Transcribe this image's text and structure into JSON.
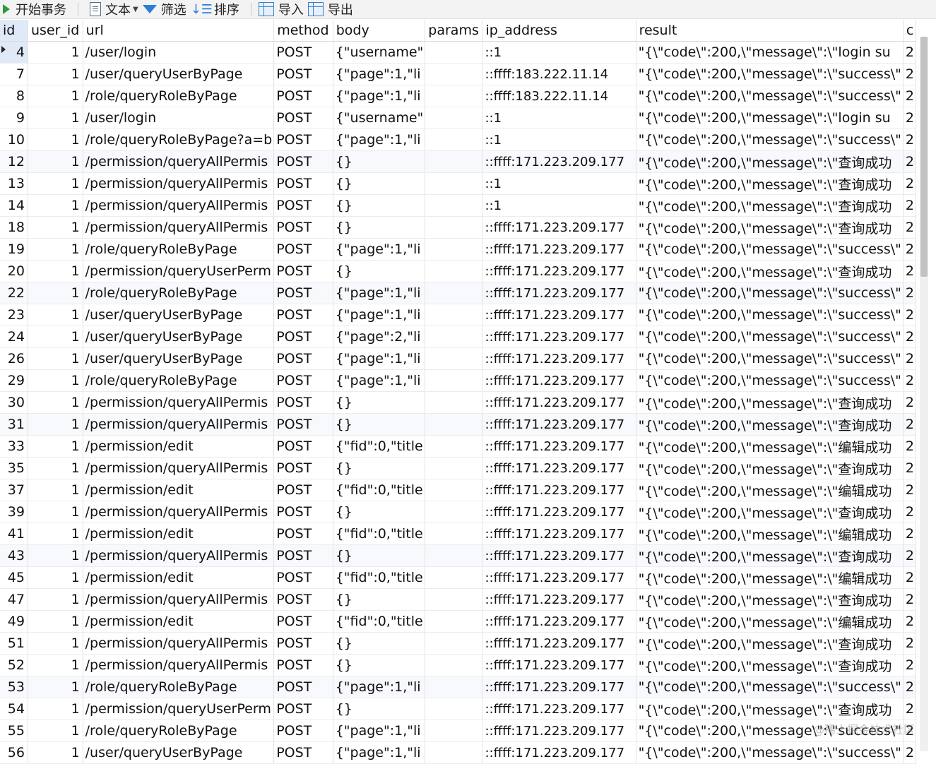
{
  "toolbar": {
    "begin_transaction": "开始事务",
    "text": "文本",
    "filter": "筛选",
    "sort": "排序",
    "import": "导入",
    "export": "导出"
  },
  "columns": [
    "id",
    "user_id",
    "url",
    "method",
    "body",
    "params",
    "ip_address",
    "result",
    "c"
  ],
  "rows": [
    [
      "4",
      "1",
      "/user/login",
      "POST",
      "{\"username\"",
      "",
      "::1",
      "\"{\\\"code\\\":200,\\\"message\\\":\\\"login su",
      "2"
    ],
    [
      "7",
      "1",
      "/user/queryUserByPage",
      "POST",
      "{\"page\":1,\"li",
      "",
      "::ffff:183.222.11.14",
      "\"{\\\"code\\\":200,\\\"message\\\":\\\"success\\\"",
      "2"
    ],
    [
      "8",
      "1",
      "/role/queryRoleByPage",
      "POST",
      "{\"page\":1,\"li",
      "",
      "::ffff:183.222.11.14",
      "\"{\\\"code\\\":200,\\\"message\\\":\\\"success\\\"",
      "2"
    ],
    [
      "9",
      "1",
      "/user/login",
      "POST",
      "{\"username\"",
      "",
      "::1",
      "\"{\\\"code\\\":200,\\\"message\\\":\\\"login su",
      "2"
    ],
    [
      "10",
      "1",
      "/role/queryRoleByPage?a=b",
      "POST",
      "{\"page\":1,\"li",
      "",
      "::1",
      "\"{\\\"code\\\":200,\\\"message\\\":\\\"success\\\"",
      "2"
    ],
    [
      "12",
      "1",
      "/permission/queryAllPermis",
      "POST",
      "{}",
      "",
      "::ffff:171.223.209.177",
      "\"{\\\"code\\\":200,\\\"message\\\":\\\"查询成功",
      "2"
    ],
    [
      "13",
      "1",
      "/permission/queryAllPermis",
      "POST",
      "{}",
      "",
      "::1",
      "\"{\\\"code\\\":200,\\\"message\\\":\\\"查询成功",
      "2"
    ],
    [
      "14",
      "1",
      "/permission/queryAllPermis",
      "POST",
      "{}",
      "",
      "::1",
      "\"{\\\"code\\\":200,\\\"message\\\":\\\"查询成功",
      "2"
    ],
    [
      "18",
      "1",
      "/permission/queryAllPermis",
      "POST",
      "{}",
      "",
      "::ffff:171.223.209.177",
      "\"{\\\"code\\\":200,\\\"message\\\":\\\"查询成功",
      "2"
    ],
    [
      "19",
      "1",
      "/role/queryRoleByPage",
      "POST",
      "{\"page\":1,\"li",
      "",
      "::ffff:171.223.209.177",
      "\"{\\\"code\\\":200,\\\"message\\\":\\\"success\\\"",
      "2"
    ],
    [
      "20",
      "1",
      "/permission/queryUserPerm",
      "POST",
      "{}",
      "",
      "::ffff:171.223.209.177",
      "\"{\\\"code\\\":200,\\\"message\\\":\\\"查询成功",
      "2"
    ],
    [
      "22",
      "1",
      "/role/queryRoleByPage",
      "POST",
      "{\"page\":1,\"li",
      "",
      "::ffff:171.223.209.177",
      "\"{\\\"code\\\":200,\\\"message\\\":\\\"success\\\"",
      "2"
    ],
    [
      "23",
      "1",
      "/user/queryUserByPage",
      "POST",
      "{\"page\":1,\"li",
      "",
      "::ffff:171.223.209.177",
      "\"{\\\"code\\\":200,\\\"message\\\":\\\"success\\\"",
      "2"
    ],
    [
      "24",
      "1",
      "/user/queryUserByPage",
      "POST",
      "{\"page\":2,\"li",
      "",
      "::ffff:171.223.209.177",
      "\"{\\\"code\\\":200,\\\"message\\\":\\\"success\\\"",
      "2"
    ],
    [
      "26",
      "1",
      "/user/queryUserByPage",
      "POST",
      "{\"page\":1,\"li",
      "",
      "::ffff:171.223.209.177",
      "\"{\\\"code\\\":200,\\\"message\\\":\\\"success\\\"",
      "2"
    ],
    [
      "29",
      "1",
      "/role/queryRoleByPage",
      "POST",
      "{\"page\":1,\"li",
      "",
      "::ffff:171.223.209.177",
      "\"{\\\"code\\\":200,\\\"message\\\":\\\"success\\\"",
      "2"
    ],
    [
      "30",
      "1",
      "/permission/queryAllPermis",
      "POST",
      "{}",
      "",
      "::ffff:171.223.209.177",
      "\"{\\\"code\\\":200,\\\"message\\\":\\\"查询成功",
      "2"
    ],
    [
      "31",
      "1",
      "/permission/queryAllPermis",
      "POST",
      "{}",
      "",
      "::ffff:171.223.209.177",
      "\"{\\\"code\\\":200,\\\"message\\\":\\\"查询成功",
      "2"
    ],
    [
      "33",
      "1",
      "/permission/edit",
      "POST",
      "{\"fid\":0,\"title",
      "",
      "::ffff:171.223.209.177",
      "\"{\\\"code\\\":200,\\\"message\\\":\\\"编辑成功",
      "2"
    ],
    [
      "35",
      "1",
      "/permission/queryAllPermis",
      "POST",
      "{}",
      "",
      "::ffff:171.223.209.177",
      "\"{\\\"code\\\":200,\\\"message\\\":\\\"查询成功",
      "2"
    ],
    [
      "37",
      "1",
      "/permission/edit",
      "POST",
      "{\"fid\":0,\"title",
      "",
      "::ffff:171.223.209.177",
      "\"{\\\"code\\\":200,\\\"message\\\":\\\"编辑成功",
      "2"
    ],
    [
      "39",
      "1",
      "/permission/queryAllPermis",
      "POST",
      "{}",
      "",
      "::ffff:171.223.209.177",
      "\"{\\\"code\\\":200,\\\"message\\\":\\\"查询成功",
      "2"
    ],
    [
      "41",
      "1",
      "/permission/edit",
      "POST",
      "{\"fid\":0,\"title",
      "",
      "::ffff:171.223.209.177",
      "\"{\\\"code\\\":200,\\\"message\\\":\\\"编辑成功",
      "2"
    ],
    [
      "43",
      "1",
      "/permission/queryAllPermis",
      "POST",
      "{}",
      "",
      "::ffff:171.223.209.177",
      "\"{\\\"code\\\":200,\\\"message\\\":\\\"查询成功",
      "2"
    ],
    [
      "45",
      "1",
      "/permission/edit",
      "POST",
      "{\"fid\":0,\"title",
      "",
      "::ffff:171.223.209.177",
      "\"{\\\"code\\\":200,\\\"message\\\":\\\"编辑成功",
      "2"
    ],
    [
      "47",
      "1",
      "/permission/queryAllPermis",
      "POST",
      "{}",
      "",
      "::ffff:171.223.209.177",
      "\"{\\\"code\\\":200,\\\"message\\\":\\\"查询成功",
      "2"
    ],
    [
      "49",
      "1",
      "/permission/edit",
      "POST",
      "{\"fid\":0,\"title",
      "",
      "::ffff:171.223.209.177",
      "\"{\\\"code\\\":200,\\\"message\\\":\\\"编辑成功",
      "2"
    ],
    [
      "51",
      "1",
      "/permission/queryAllPermis",
      "POST",
      "{}",
      "",
      "::ffff:171.223.209.177",
      "\"{\\\"code\\\":200,\\\"message\\\":\\\"查询成功",
      "2"
    ],
    [
      "52",
      "1",
      "/permission/queryAllPermis",
      "POST",
      "{}",
      "",
      "::ffff:171.223.209.177",
      "\"{\\\"code\\\":200,\\\"message\\\":\\\"查询成功",
      "2"
    ],
    [
      "53",
      "1",
      "/role/queryRoleByPage",
      "POST",
      "{\"page\":1,\"li",
      "",
      "::ffff:171.223.209.177",
      "\"{\\\"code\\\":200,\\\"message\\\":\\\"success\\\"",
      "2"
    ],
    [
      "54",
      "1",
      "/permission/queryUserPerm",
      "POST",
      "{}",
      "",
      "::ffff:171.223.209.177",
      "\"{\\\"code\\\":200,\\\"message\\\":\\\"查询成功",
      "2"
    ],
    [
      "55",
      "1",
      "/role/queryRoleByPage",
      "POST",
      "{\"page\":1,\"li",
      "",
      "::ffff:171.223.209.177",
      "\"{\\\"code\\\":200,\\\"message\\\":\\\"success\\\"",
      "2"
    ],
    [
      "56",
      "1",
      "/user/queryUserByPage",
      "POST",
      "{\"page\":1,\"li",
      "",
      "::ffff:171.223.209.177",
      "\"{\\\"code\\\":200,\\\"message\\\":\\\"success\\\"",
      "2"
    ]
  ],
  "watermark": "@稀土掘金技术社区"
}
